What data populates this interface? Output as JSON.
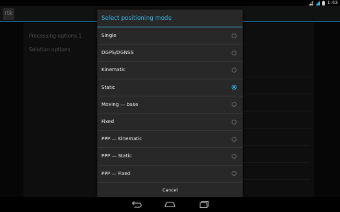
{
  "status_bar": {
    "time": "1:43"
  },
  "action_bar": {
    "app_icon": "rtk"
  },
  "settings": {
    "items": [
      {
        "label": "Processing options 1"
      },
      {
        "label": "Solution options"
      }
    ]
  },
  "dialog": {
    "title": "Select positioning mode",
    "options": [
      {
        "label": "Single",
        "checked": false
      },
      {
        "label": "DGPS/DGNSS",
        "checked": false
      },
      {
        "label": "Kinematic",
        "checked": false
      },
      {
        "label": "Static",
        "checked": true
      },
      {
        "label": "Moving — base",
        "checked": false
      },
      {
        "label": "Fixed",
        "checked": false
      },
      {
        "label": "PPP — Kinematic",
        "checked": false
      },
      {
        "label": "PPP — Static",
        "checked": false
      },
      {
        "label": "PPP — Fixed",
        "checked": false
      }
    ],
    "cancel": "Cancel"
  },
  "nav_bar": {
    "icons": [
      "back-icon",
      "home-icon",
      "recent-apps-icon"
    ]
  },
  "colors": {
    "accent": "#33b5e5",
    "dialog_bg": "#282828"
  }
}
